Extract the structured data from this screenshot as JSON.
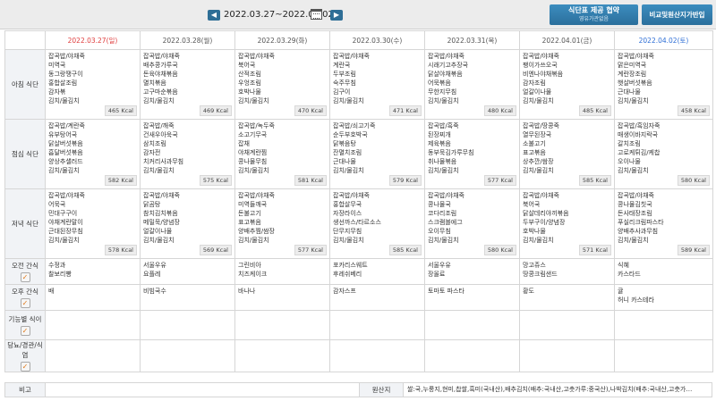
{
  "header": {
    "date_range": "2022.03.27~2022.04.02",
    "btn_supply_line1": "식단표 제공 협약",
    "btn_supply_line2": "영유가관없음",
    "btn_compare": "비교및원산지가반입",
    "colors": {
      "accent": "#2e6e96",
      "sunday": "#e04040",
      "saturday": "#2f6fd6"
    }
  },
  "days": [
    {
      "date": "2022.03.27(일)"
    },
    {
      "date": "2022.03.28(월)"
    },
    {
      "date": "2022.03.29(화)"
    },
    {
      "date": "2022.03.30(수)"
    },
    {
      "date": "2022.03.31(목)"
    },
    {
      "date": "2022.04.01(금)"
    },
    {
      "date": "2022.04.02(토)"
    }
  ],
  "rows": {
    "breakfast": {
      "label": "아침 식단",
      "cells": [
        {
          "items": [
            "잡곡밥/야채죽",
            "미역국",
            "동그랑땡구이",
            "홍합살조림",
            "감자볶",
            "김치/물김치"
          ],
          "kcal": "465 Kcal"
        },
        {
          "items": [
            "잡곡밥/야채죽",
            "배추콩가루국",
            "돈육야채볶음",
            "멸치볶음",
            "고구마순볶음",
            "김치/물김치"
          ],
          "kcal": "469 Kcal"
        },
        {
          "items": [
            "잡곡밥/야채죽",
            "북어국",
            "산적조림",
            "우엉조림",
            "호박나물",
            "김치/물김치"
          ],
          "kcal": "470 Kcal"
        },
        {
          "items": [
            "잡곡밥/야채죽",
            "계란국",
            "두부조림",
            "숙주무침",
            "김구이",
            "김치/물김치"
          ],
          "kcal": "471 Kcal"
        },
        {
          "items": [
            "잡곡밥/야채죽",
            "시래기고추장국",
            "닭살야채볶음",
            "어묵볶음",
            "무한지무침",
            "김치/물김치"
          ],
          "kcal": "480 Kcal"
        },
        {
          "items": [
            "잡곡밥/야채죽",
            "팽이가쓰오국",
            "비엔나야채볶음",
            "감자조림",
            "얼갈이나물",
            "김치/물김치"
          ],
          "kcal": "485 Kcal"
        },
        {
          "items": [
            "잡곡밥/야채죽",
            "맑은미역국",
            "계란장조림",
            "햇살버섯볶음",
            "근대나물",
            "김치/물김치"
          ],
          "kcal": "458 Kcal"
        }
      ]
    },
    "lunch": {
      "label": "점심 식단",
      "cells": [
        {
          "items": [
            "잡곡밥/계란죽",
            "유부탕어국",
            "닭살버섯볶음",
            "흡달버섯볶음",
            "양상추샐러드",
            "김치/물김치"
          ],
          "kcal": "582 Kcal"
        },
        {
          "items": [
            "잡곡밥/깨죽",
            "건새우아욱국",
            "삼치조림",
            "감자전",
            "치커리사과무침",
            "김치/물김치"
          ],
          "kcal": "575 Kcal"
        },
        {
          "items": [
            "잡곡밥/녹두죽",
            "소고기무국",
            "잡채",
            "야채계란찜",
            "콩나물무침",
            "김치/물김치"
          ],
          "kcal": "581 Kcal"
        },
        {
          "items": [
            "잡곡밥/쇠고기죽",
            "순두부호박국",
            "닭볶음탕",
            "잔멸치조림",
            "근대나물",
            "김치/물김치"
          ],
          "kcal": "579 Kcal"
        },
        {
          "items": [
            "잡곡밥/흑죽",
            "된장찌개",
            "제육볶음",
            "동부묵김가루무침",
            "취나물볶음",
            "김치/물김치"
          ],
          "kcal": "577 Kcal"
        },
        {
          "items": [
            "잡곡밥/땅콩죽",
            "열무된장국",
            "소불고기",
            "표고볶음",
            "상추깐/쌈장",
            "김치/물김치"
          ],
          "kcal": "585 Kcal"
        },
        {
          "items": [
            "잡곡밥/흑임자죽",
            "매생이바지락국",
            "갈치조림",
            "고로케튀김/케찹",
            "오이나물",
            "김치/물김치"
          ],
          "kcal": "580 Kcal"
        }
      ]
    },
    "dinner": {
      "label": "저녁 식단",
      "cells": [
        {
          "items": [
            "잡곡밥/야채죽",
            "어묵국",
            "민대구구이",
            "야채계란말이",
            "근대된장무침",
            "김치/물김치"
          ],
          "kcal": "578 Kcal"
        },
        {
          "items": [
            "잡곡밥/야채죽",
            "닭곰탕",
            "참치김치볶음",
            "메밀묵/양념장",
            "얼갈이나물",
            "김치/물김치"
          ],
          "kcal": "569 Kcal"
        },
        {
          "items": [
            "잡곡밥/야채죽",
            "미역들깨국",
            "돈불고기",
            "표고볶음",
            "양배추찜/쌈장",
            "김치/물김치"
          ],
          "kcal": "577 Kcal"
        },
        {
          "items": [
            "잡곡밥/야채죽",
            "홍합살무국",
            "자장라이스",
            "생선까스/타르소스",
            "단무지무침",
            "김치/물김치"
          ],
          "kcal": "585 Kcal"
        },
        {
          "items": [
            "잡곡밥/야채죽",
            "콩나물국",
            "코다리조림",
            "스크램블에그",
            "오이무침",
            "김치/물김치"
          ],
          "kcal": "580 Kcal"
        },
        {
          "items": [
            "잡곡밥/야채죽",
            "북어국",
            "닭살데리야끼볶음",
            "두부구이/양념장",
            "호박나물",
            "김치/물김치"
          ],
          "kcal": "571 Kcal"
        },
        {
          "items": [
            "잡곡밥/야채죽",
            "콩나물김칫국",
            "돈사태장조림",
            "푸실리크림파스타",
            "양배추사과무침",
            "김치/물김치"
          ],
          "kcal": "589 Kcal"
        }
      ]
    },
    "am_snack": {
      "label": "오전 간식",
      "cells": [
        {
          "items": [
            "수정과",
            "찰보리빵"
          ]
        },
        {
          "items": [
            "서울우유",
            "요플레"
          ]
        },
        {
          "items": [
            "그린비아",
            "치즈케이크"
          ]
        },
        {
          "items": [
            "포카리스웨트",
            "후레쉬베리"
          ]
        },
        {
          "items": [
            "서울우유",
            "장올료"
          ]
        },
        {
          "items": [
            "망고쥬스",
            "땅콩크림샌드"
          ]
        },
        {
          "items": [
            "식혜",
            "카스타드"
          ]
        }
      ]
    },
    "pm_snack": {
      "label": "오후 간식",
      "cells": [
        {
          "items": [
            "배"
          ]
        },
        {
          "items": [
            "비빔국수"
          ]
        },
        {
          "items": [
            "바나나"
          ]
        },
        {
          "items": [
            "감자스프"
          ]
        },
        {
          "items": [
            "토마토 파스타"
          ]
        },
        {
          "items": [
            "황도"
          ]
        },
        {
          "items": [
            "귤",
            "허니 카스테라"
          ]
        }
      ]
    },
    "functional": {
      "label": "기능별 식이"
    },
    "diabetic": {
      "label": "당뇨/경관/식염"
    }
  },
  "footer": {
    "remarks_label": "비고",
    "origin_label": "원산지",
    "origin_value": "쌀:국,누룽지,현미,찹쌀,흑미(국내산),배추김치(배추:국내산,고춧가루:중국산),나박김치(배추:국내산,고춧가…"
  }
}
